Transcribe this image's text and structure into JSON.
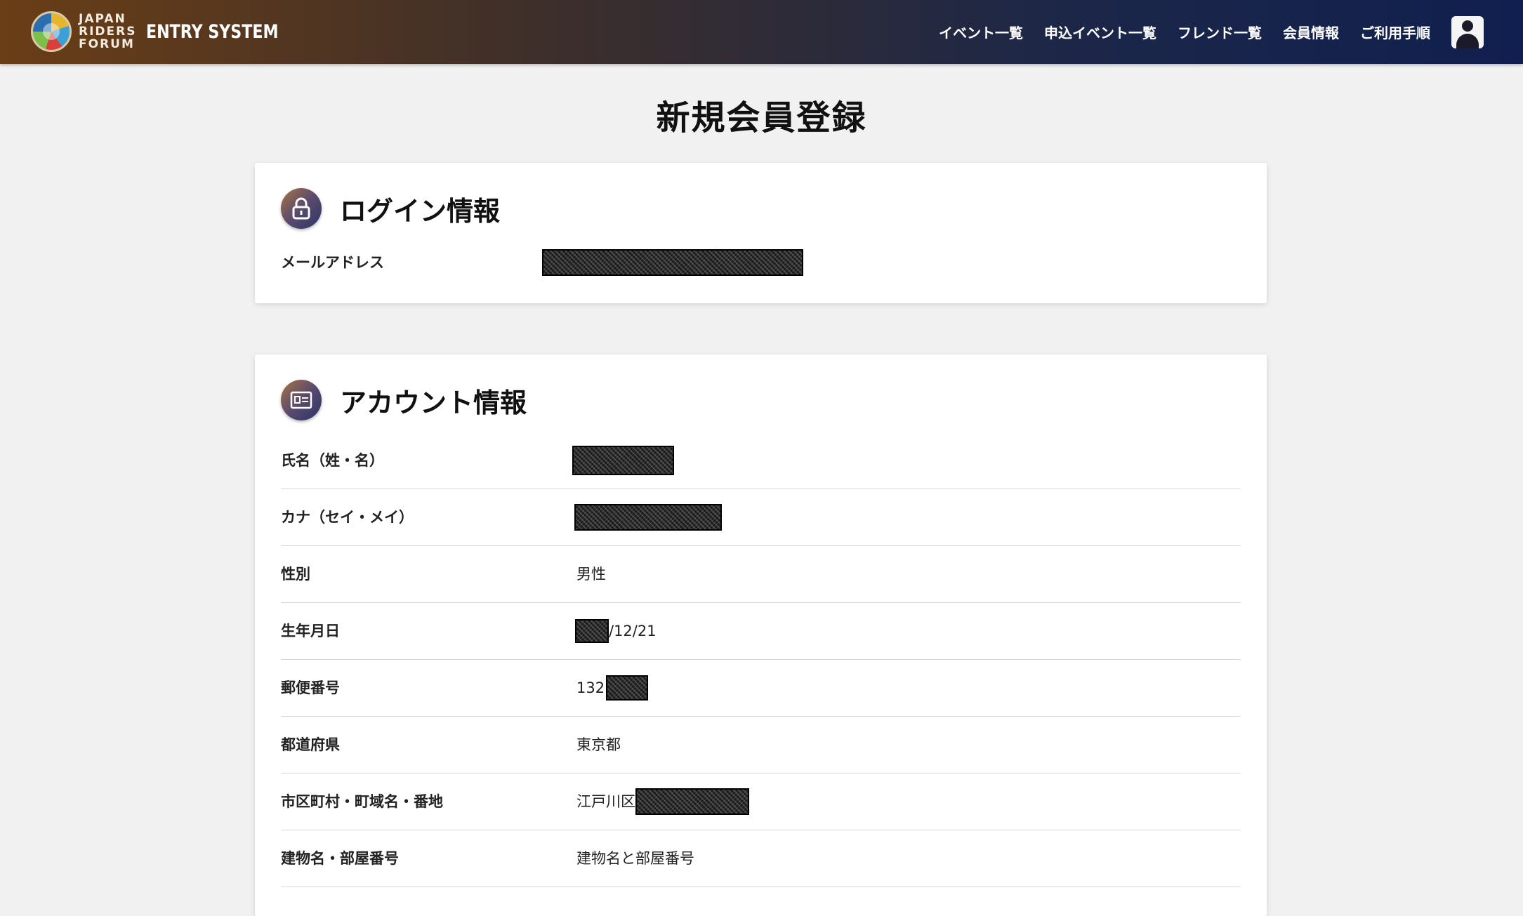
{
  "header": {
    "logo_lines": [
      "JAPAN",
      "RIDERS",
      "FORUM"
    ],
    "logo_system": "ENTRY SYSTEM",
    "nav": [
      {
        "label": "イベント一覧"
      },
      {
        "label": "申込イベント一覧"
      },
      {
        "label": "フレンド一覧"
      },
      {
        "label": "会員情報"
      },
      {
        "label": "ご利用手順"
      }
    ]
  },
  "page_title": "新規会員登録",
  "login_section": {
    "title": "ログイン情報",
    "email_label": "メールアドレス",
    "email_value_redacted": true
  },
  "account_section": {
    "title": "アカウント情報",
    "fields": {
      "name_label": "氏名（姓・名）",
      "kana_label": "カナ（セイ・メイ）",
      "gender_label": "性別",
      "gender_value": "男性",
      "birth_label": "生年月日",
      "birth_value_suffix": "/12/21",
      "postal_label": "郵便番号",
      "postal_value_prefix": "132",
      "prefecture_label": "都道府県",
      "prefecture_value": "東京都",
      "city_label": "市区町村・町域名・番地",
      "city_value_prefix": "江戸川区",
      "building_label": "建物名・部屋番号",
      "building_value": "建物名と部屋番号"
    }
  },
  "colors": {
    "header_left": "#6a3e16",
    "header_right": "#101f4f",
    "page_bg": "#f1f1f1"
  },
  "icons": [
    "lock-icon",
    "id-card-icon",
    "user-avatar-icon"
  ]
}
